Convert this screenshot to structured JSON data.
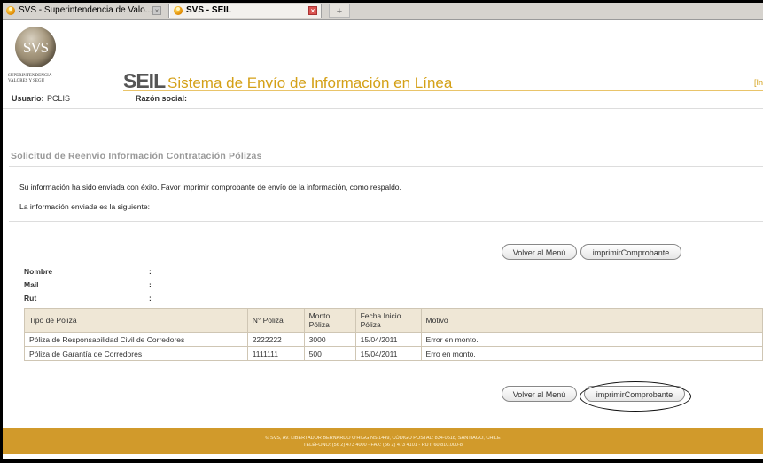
{
  "tabs": [
    {
      "title": "SVS - Superintendencia de Valo...",
      "close": "×"
    },
    {
      "title": "SVS - SEIL",
      "close": "×"
    }
  ],
  "new_tab": "+",
  "header": {
    "logo_text": "SVS",
    "logo_sub": "SUPERINTENDENCIA VALORES Y SEGU",
    "seil": "SEIL",
    "subtitle": "Sistema de Envío de Información en Línea",
    "edge_text": "[In"
  },
  "user_row": {
    "usuario_label": "Usuario:",
    "usuario_value": "PCLIS",
    "razon_label": "Razón social:"
  },
  "page_title": "Solicitud de Reenvio Información Contratación Pólizas",
  "messages": {
    "line1": "Su información ha sido enviada con éxito. Favor imprimir comprobante de envío de la información, como respaldo.",
    "line2": "La información enviada es la siguiente:"
  },
  "buttons": {
    "volver": "Volver al Menú",
    "imprimir": "imprimirComprobante"
  },
  "info": {
    "nombre_label": "Nombre",
    "mail_label": "Mail",
    "rut_label": "Rut",
    "colon": ":"
  },
  "table": {
    "headers": [
      "Tipo de Póliza",
      "N° Póliza",
      "Monto Póliza",
      "Fecha Inicio Póliza",
      "Motivo"
    ],
    "rows": [
      [
        "Póliza de Responsabilidad Civil de Corredores",
        "2222222",
        "3000",
        "15/04/2011",
        "Error en monto."
      ],
      [
        "Póliza de Garantía de Corredores",
        "1111111",
        "500",
        "15/04/2011",
        "Erro en monto."
      ]
    ]
  },
  "footer": {
    "line1": "© SVS, AV. LIBERTADOR BERNARDO O'HIGGINS 1449, CÓDIGO POSTAL: 834-0518, SANTIAGO, CHILE",
    "line2": "TELÉFONO: (56 2) 473 4000 - FAX: (56 2) 473 4101 - RUT: 60.810.000-8"
  }
}
